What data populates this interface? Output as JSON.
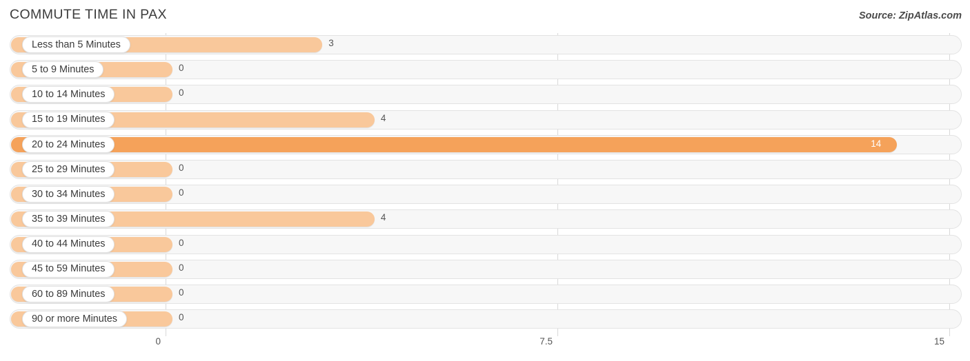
{
  "header": {
    "title": "COMMUTE TIME IN PAX",
    "source": "Source: ZipAtlas.com"
  },
  "colors": {
    "bar": "#f9c89b",
    "bar_highlight": "#f5a25a",
    "track": "#f7f7f7",
    "track_border": "#e3e3e3",
    "gridline": "#d8d8d8",
    "text": "#3a3a3a",
    "value_text": "#555555",
    "value_text_inverse": "#ffffff"
  },
  "chart_data": {
    "type": "bar",
    "orientation": "horizontal",
    "title": "COMMUTE TIME IN PAX",
    "subtitle": "",
    "xlabel": "",
    "ylabel": "",
    "xlim": [
      0,
      15
    ],
    "xticks": [
      "0",
      "7.5",
      "15"
    ],
    "xtick_values": [
      0,
      7.5,
      15
    ],
    "grid": true,
    "legend": "none",
    "source": "Source: ZipAtlas.com",
    "highlight_category": "20 to 24 Minutes",
    "categories": [
      "Less than 5 Minutes",
      "5 to 9 Minutes",
      "10 to 14 Minutes",
      "15 to 19 Minutes",
      "20 to 24 Minutes",
      "25 to 29 Minutes",
      "30 to 34 Minutes",
      "35 to 39 Minutes",
      "40 to 44 Minutes",
      "45 to 59 Minutes",
      "60 to 89 Minutes",
      "90 or more Minutes"
    ],
    "values": [
      3,
      0,
      0,
      4,
      14,
      0,
      0,
      4,
      0,
      0,
      0,
      0
    ],
    "value_labels": [
      "3",
      "0",
      "0",
      "4",
      "14",
      "0",
      "0",
      "4",
      "0",
      "0",
      "0",
      "0"
    ],
    "rows": [
      {
        "label": "Less than 5 Minutes",
        "value": 3,
        "value_label": "3",
        "highlight": false
      },
      {
        "label": "5 to 9 Minutes",
        "value": 0,
        "value_label": "0",
        "highlight": false
      },
      {
        "label": "10 to 14 Minutes",
        "value": 0,
        "value_label": "0",
        "highlight": false
      },
      {
        "label": "15 to 19 Minutes",
        "value": 4,
        "value_label": "4",
        "highlight": false
      },
      {
        "label": "20 to 24 Minutes",
        "value": 14,
        "value_label": "14",
        "highlight": true
      },
      {
        "label": "25 to 29 Minutes",
        "value": 0,
        "value_label": "0",
        "highlight": false
      },
      {
        "label": "30 to 34 Minutes",
        "value": 0,
        "value_label": "0",
        "highlight": false
      },
      {
        "label": "35 to 39 Minutes",
        "value": 4,
        "value_label": "4",
        "highlight": false
      },
      {
        "label": "40 to 44 Minutes",
        "value": 0,
        "value_label": "0",
        "highlight": false
      },
      {
        "label": "45 to 59 Minutes",
        "value": 0,
        "value_label": "0",
        "highlight": false
      },
      {
        "label": "60 to 89 Minutes",
        "value": 0,
        "value_label": "0",
        "highlight": false
      },
      {
        "label": "90 or more Minutes",
        "value": 0,
        "value_label": "0",
        "highlight": false
      }
    ]
  }
}
